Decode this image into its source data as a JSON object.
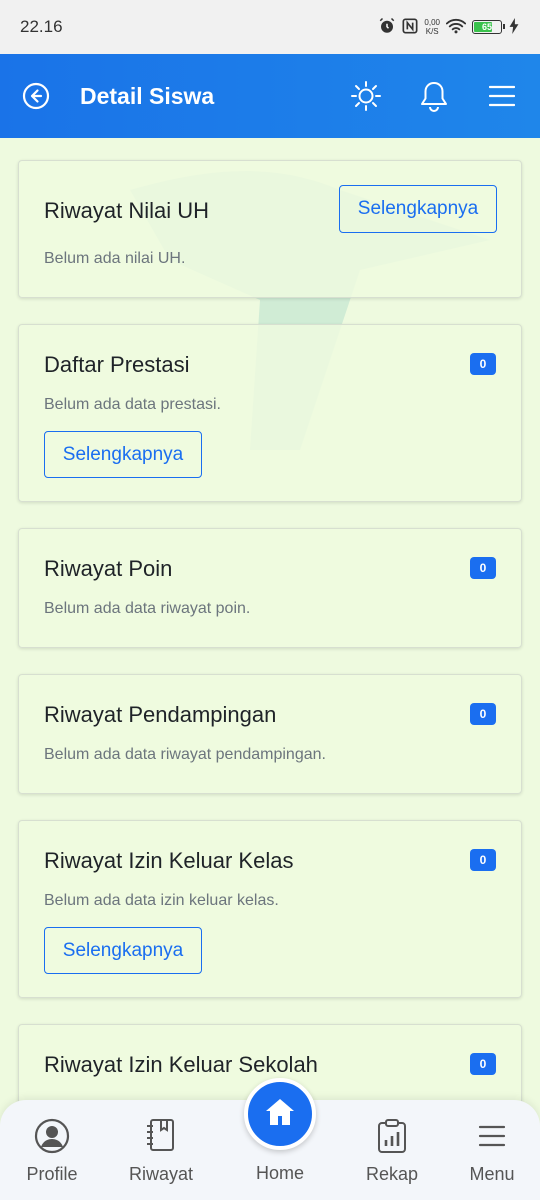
{
  "status_bar": {
    "time": "22.16",
    "net_speed_value": "0,00",
    "net_speed_unit": "K/S",
    "battery": "65"
  },
  "header": {
    "title": "Detail Siswa"
  },
  "cards": {
    "nilai_uh": {
      "title": "Riwayat Nilai UH",
      "button": "Selengkapnya",
      "empty": "Belum ada nilai UH."
    },
    "prestasi": {
      "title": "Daftar Prestasi",
      "badge": "0",
      "empty": "Belum ada data prestasi.",
      "button": "Selengkapnya"
    },
    "poin": {
      "title": "Riwayat Poin",
      "badge": "0",
      "empty": "Belum ada data riwayat poin."
    },
    "pendampingan": {
      "title": "Riwayat Pendampingan",
      "badge": "0",
      "empty": "Belum ada data riwayat pendampingan."
    },
    "izin_kelas": {
      "title": "Riwayat Izin Keluar Kelas",
      "badge": "0",
      "empty": "Belum ada data izin keluar kelas.",
      "button": "Selengkapnya"
    },
    "izin_sekolah": {
      "title": "Riwayat Izin Keluar Sekolah",
      "badge": "0"
    }
  },
  "bottom_nav": {
    "profile": "Profile",
    "riwayat": "Riwayat",
    "home": "Home",
    "rekap": "Rekap",
    "menu": "Menu"
  },
  "colors": {
    "primary": "#1a6ef0",
    "header": "#1a73e8",
    "background": "#eefadf"
  },
  "icons": [
    "alarm-icon",
    "nfc-icon",
    "wifi-icon",
    "battery-icon",
    "charging-icon",
    "back-circle-icon",
    "sun-icon",
    "bell-icon",
    "hamburger-icon",
    "user-circle-icon",
    "book-icon",
    "home-icon",
    "clipboard-chart-icon",
    "menu-icon"
  ]
}
